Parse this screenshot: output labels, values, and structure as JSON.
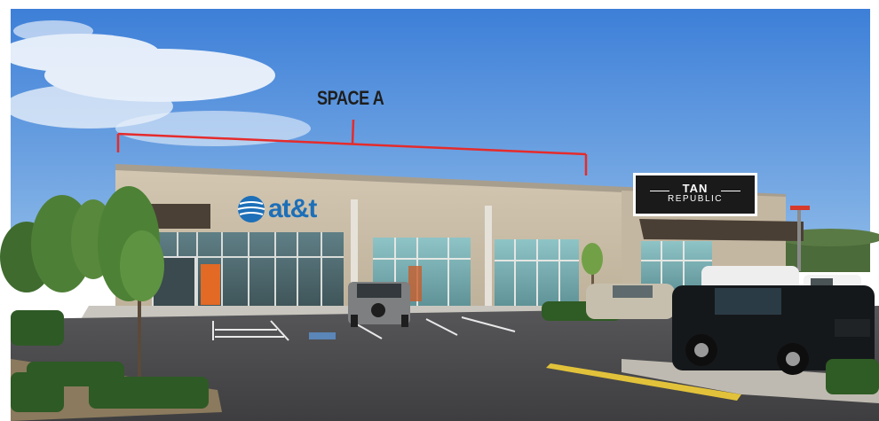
{
  "callout": {
    "label": "SPACE A"
  },
  "signs": {
    "main_store": "at&t",
    "neighbor_line1": "TAN",
    "neighbor_line2": "REPUBLIC"
  },
  "colors": {
    "sky": "#4a86d6",
    "bracket": "#e52b2b",
    "facade": "#c9bda8",
    "att_blue": "#1d6fb8",
    "asphalt": "#4a4a4c"
  }
}
